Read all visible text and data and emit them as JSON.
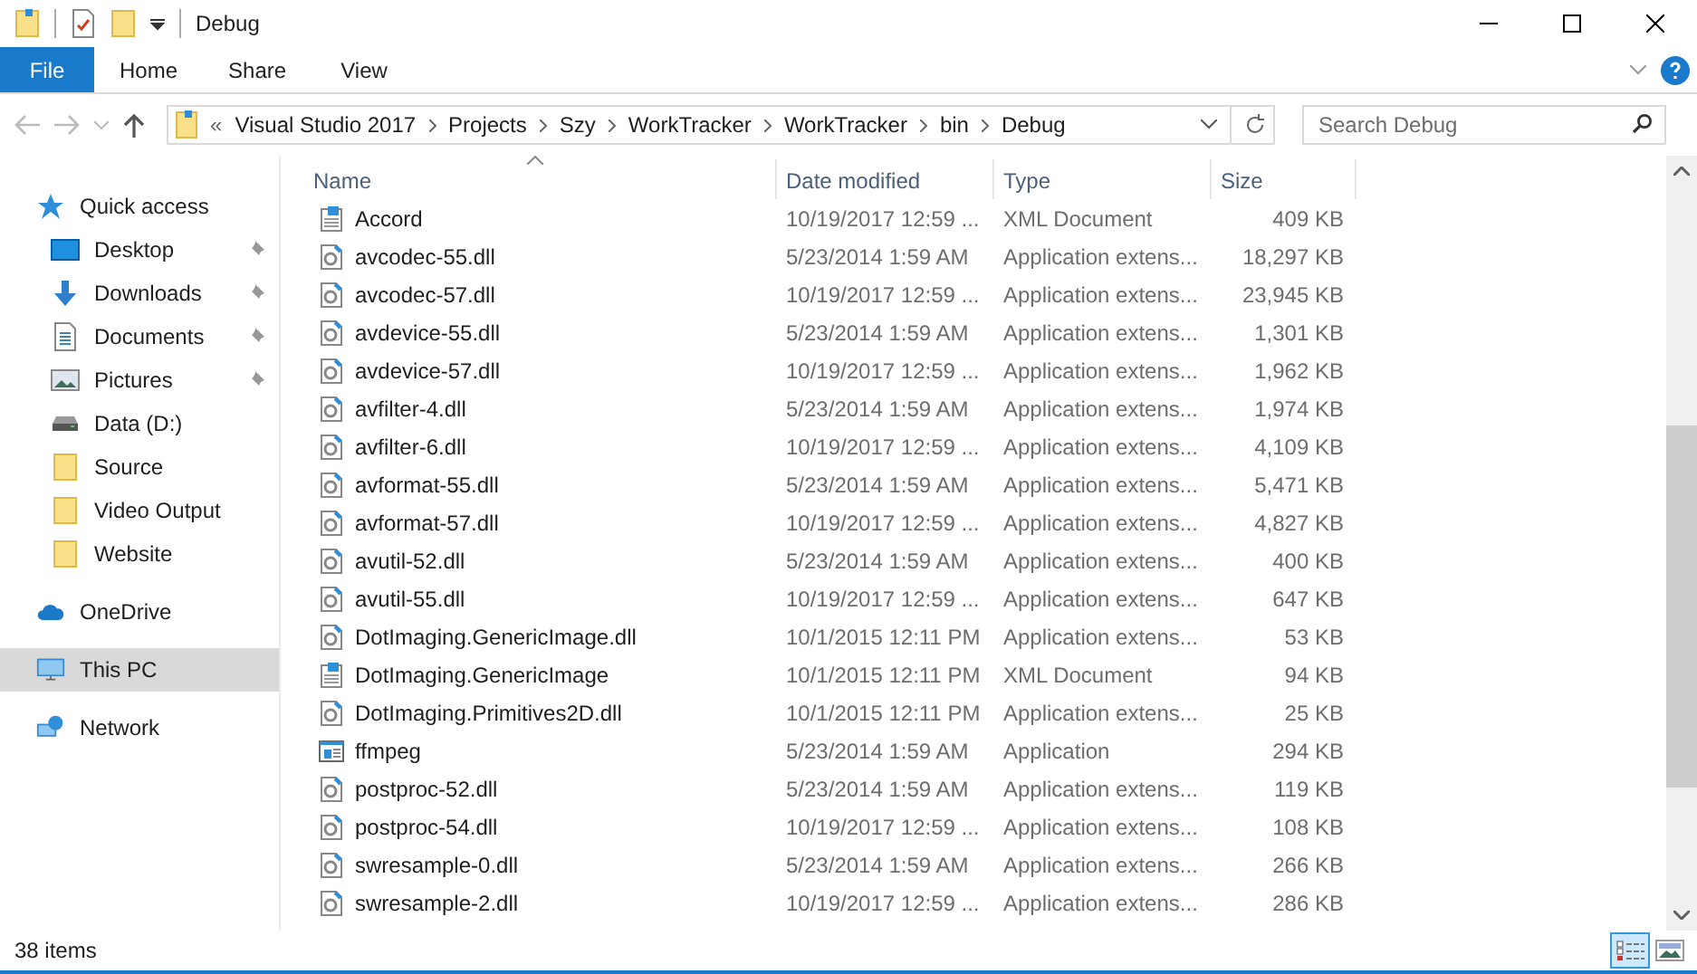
{
  "window": {
    "title": "Debug"
  },
  "ribbon_tabs": [
    {
      "label": "File",
      "selected": true
    },
    {
      "label": "Home",
      "selected": false
    },
    {
      "label": "Share",
      "selected": false
    },
    {
      "label": "View",
      "selected": false
    }
  ],
  "address_bar": {
    "overflow": "«",
    "path": [
      "Visual Studio 2017",
      "Projects",
      "Szy",
      "WorkTracker",
      "WorkTracker",
      "bin",
      "Debug"
    ]
  },
  "search": {
    "placeholder": "Search Debug"
  },
  "sidebar": {
    "items": [
      {
        "label": "Quick access",
        "kind": "star",
        "selected": false,
        "children": [
          {
            "label": "Desktop",
            "kind": "desktop",
            "pinned": true,
            "selected": false
          },
          {
            "label": "Downloads",
            "kind": "download",
            "pinned": true,
            "selected": false
          },
          {
            "label": "Documents",
            "kind": "document",
            "pinned": true,
            "selected": false
          },
          {
            "label": "Pictures",
            "kind": "pictures",
            "pinned": true,
            "selected": false
          },
          {
            "label": "Data (D:)",
            "kind": "drive",
            "pinned": false,
            "selected": false
          },
          {
            "label": "Source",
            "kind": "folder",
            "pinned": false,
            "selected": false
          },
          {
            "label": "Video Output",
            "kind": "folder",
            "pinned": false,
            "selected": false
          },
          {
            "label": "Website",
            "kind": "folder",
            "pinned": false,
            "selected": false
          }
        ]
      },
      {
        "label": "OneDrive",
        "kind": "cloud",
        "selected": false
      },
      {
        "label": "This PC",
        "kind": "pc",
        "selected": true
      },
      {
        "label": "Network",
        "kind": "network",
        "selected": false
      }
    ]
  },
  "table": {
    "columns": [
      "Name",
      "Date modified",
      "Type",
      "Size"
    ],
    "rows": [
      {
        "kind": "xml",
        "name": "Accord",
        "date": "10/19/2017 12:59 ...",
        "type": "XML Document",
        "size": "409 KB"
      },
      {
        "kind": "dll",
        "name": "avcodec-55.dll",
        "date": "5/23/2014 1:59 AM",
        "type": "Application extens...",
        "size": "18,297 KB"
      },
      {
        "kind": "dll",
        "name": "avcodec-57.dll",
        "date": "10/19/2017 12:59 ...",
        "type": "Application extens...",
        "size": "23,945 KB"
      },
      {
        "kind": "dll",
        "name": "avdevice-55.dll",
        "date": "5/23/2014 1:59 AM",
        "type": "Application extens...",
        "size": "1,301 KB"
      },
      {
        "kind": "dll",
        "name": "avdevice-57.dll",
        "date": "10/19/2017 12:59 ...",
        "type": "Application extens...",
        "size": "1,962 KB"
      },
      {
        "kind": "dll",
        "name": "avfilter-4.dll",
        "date": "5/23/2014 1:59 AM",
        "type": "Application extens...",
        "size": "1,974 KB"
      },
      {
        "kind": "dll",
        "name": "avfilter-6.dll",
        "date": "10/19/2017 12:59 ...",
        "type": "Application extens...",
        "size": "4,109 KB"
      },
      {
        "kind": "dll",
        "name": "avformat-55.dll",
        "date": "5/23/2014 1:59 AM",
        "type": "Application extens...",
        "size": "5,471 KB"
      },
      {
        "kind": "dll",
        "name": "avformat-57.dll",
        "date": "10/19/2017 12:59 ...",
        "type": "Application extens...",
        "size": "4,827 KB"
      },
      {
        "kind": "dll",
        "name": "avutil-52.dll",
        "date": "5/23/2014 1:59 AM",
        "type": "Application extens...",
        "size": "400 KB"
      },
      {
        "kind": "dll",
        "name": "avutil-55.dll",
        "date": "10/19/2017 12:59 ...",
        "type": "Application extens...",
        "size": "647 KB"
      },
      {
        "kind": "dll",
        "name": "DotImaging.GenericImage.dll",
        "date": "10/1/2015 12:11 PM",
        "type": "Application extens...",
        "size": "53 KB"
      },
      {
        "kind": "xml",
        "name": "DotImaging.GenericImage",
        "date": "10/1/2015 12:11 PM",
        "type": "XML Document",
        "size": "94 KB"
      },
      {
        "kind": "dll",
        "name": "DotImaging.Primitives2D.dll",
        "date": "10/1/2015 12:11 PM",
        "type": "Application extens...",
        "size": "25 KB"
      },
      {
        "kind": "app",
        "name": "ffmpeg",
        "date": "5/23/2014 1:59 AM",
        "type": "Application",
        "size": "294 KB"
      },
      {
        "kind": "dll",
        "name": "postproc-52.dll",
        "date": "5/23/2014 1:59 AM",
        "type": "Application extens...",
        "size": "119 KB"
      },
      {
        "kind": "dll",
        "name": "postproc-54.dll",
        "date": "10/19/2017 12:59 ...",
        "type": "Application extens...",
        "size": "108 KB"
      },
      {
        "kind": "dll",
        "name": "swresample-0.dll",
        "date": "5/23/2014 1:59 AM",
        "type": "Application extens...",
        "size": "266 KB"
      },
      {
        "kind": "dll",
        "name": "swresample-2.dll",
        "date": "10/19/2017 12:59 ...",
        "type": "Application extens...",
        "size": "286 KB"
      }
    ]
  },
  "status_bar": {
    "item_count": "38 items",
    "views": [
      {
        "kind": "details",
        "selected": true
      },
      {
        "kind": "thumbnails",
        "selected": false
      }
    ]
  }
}
